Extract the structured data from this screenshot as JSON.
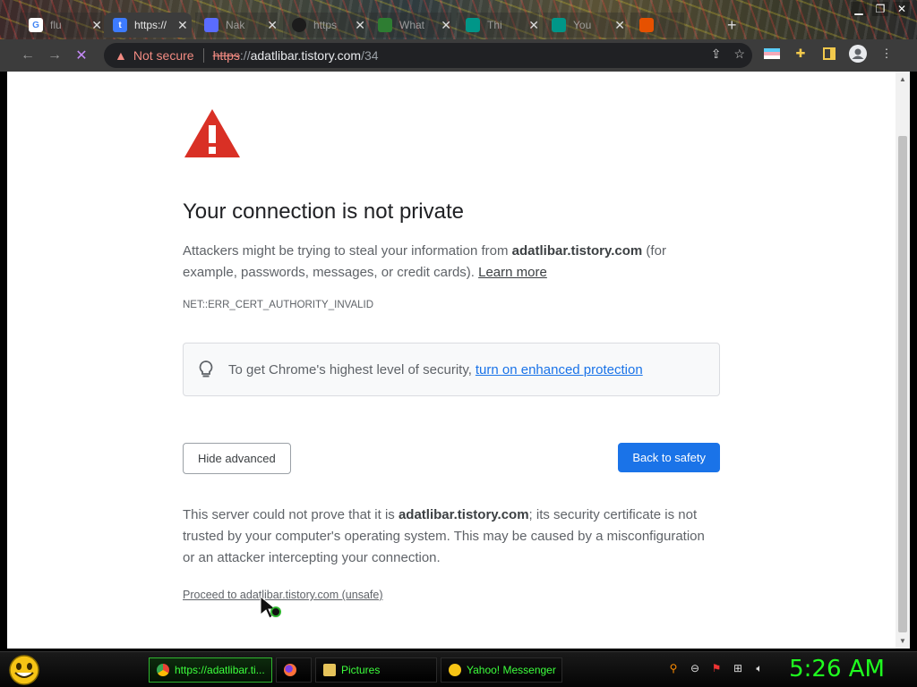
{
  "browser": {
    "tabs": [
      {
        "label": "flu",
        "favicon": "google-icon",
        "fav_color": "#4285f4",
        "active": false
      },
      {
        "label": "https://",
        "favicon": "tistory-icon",
        "fav_color": "#3d7bff",
        "active": true
      },
      {
        "label": "Nak",
        "favicon": "page-icon",
        "fav_color": "#5a6cff",
        "active": false
      },
      {
        "label": "https",
        "favicon": "github-icon",
        "fav_color": "#1c1c1c",
        "active": false
      },
      {
        "label": "What",
        "favicon": "page-icon",
        "fav_color": "#2e7d32",
        "active": false
      },
      {
        "label": "Thi",
        "favicon": "site-icon",
        "fav_color": "#009688",
        "active": false
      },
      {
        "label": "You",
        "favicon": "site-icon",
        "fav_color": "#009688",
        "active": false
      },
      {
        "label": "",
        "favicon": "site-icon",
        "fav_color": "#e65100",
        "active": false
      }
    ],
    "omnibox": {
      "security_label": "Not secure",
      "url_scheme": "https",
      "url_sep": "://",
      "url_host": "adatlibar.tistory.com",
      "url_path": "/34"
    }
  },
  "page": {
    "heading": "Your connection is not private",
    "intro_pre": "Attackers might be trying to steal your information from ",
    "intro_domain": "adatlibar.tistory.com",
    "intro_post": " (for example, passwords, messages, or credit cards). ",
    "learn_more": "Learn more",
    "error_code": "NET::ERR_CERT_AUTHORITY_INVALID",
    "enhanced_text": "To get Chrome's highest level of security,",
    "enhanced_link": "turn on enhanced protection",
    "hide_advanced": "Hide advanced",
    "back_to_safety": "Back to safety",
    "details_pre": "This server could not prove that it is ",
    "details_domain": "adatlibar.tistory.com",
    "details_post": "; its security certificate is not trusted by your computer's operating system. This may be caused by a misconfiguration or an attacker intercepting your connection.",
    "proceed": "Proceed to adatlibar.tistory.com (unsafe)"
  },
  "taskbar": {
    "tasks": [
      {
        "label": "https://adatlibar.ti...",
        "icon": "chrome-icon",
        "active": true
      },
      {
        "label": "",
        "icon": "firefox-icon",
        "active": false
      },
      {
        "label": "Pictures",
        "icon": "folder-icon",
        "active": false
      },
      {
        "label": "Yahoo! Messenger",
        "icon": "messenger-icon",
        "active": false
      }
    ],
    "clock": "5:26 AM"
  },
  "colors": {
    "accent_blue": "#1a73e8",
    "danger_red": "#d93025",
    "taskbar_green": "#1fff1f"
  }
}
